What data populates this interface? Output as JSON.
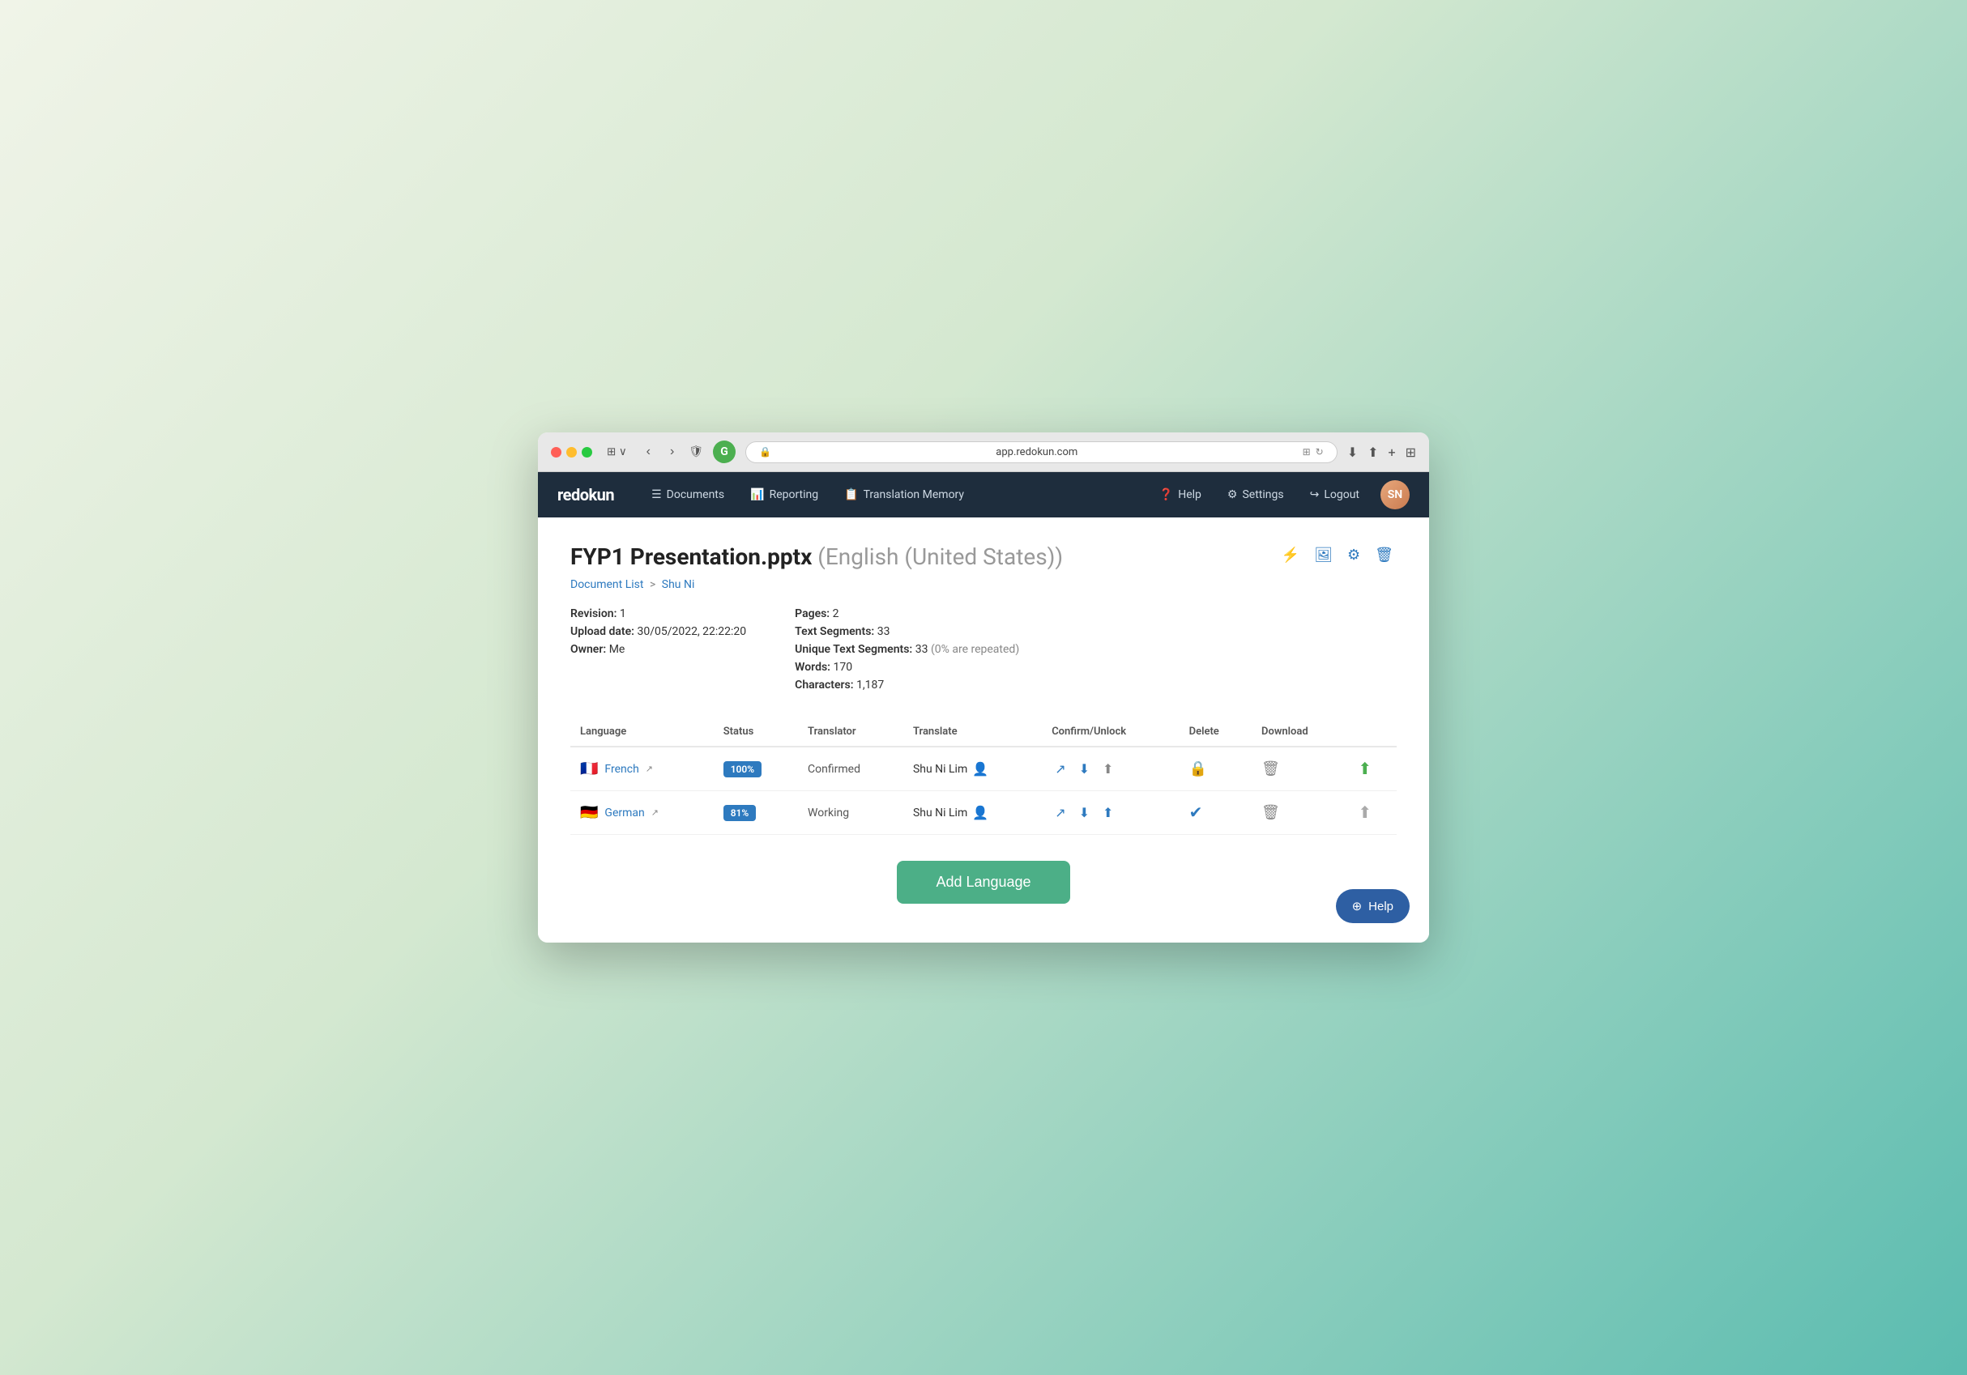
{
  "browser": {
    "url": "app.redokun.com"
  },
  "navbar": {
    "logo": "redokun",
    "links": [
      {
        "id": "documents",
        "icon": "☰",
        "label": "Documents"
      },
      {
        "id": "reporting",
        "icon": "📊",
        "label": "Reporting"
      },
      {
        "id": "translation-memory",
        "icon": "📋",
        "label": "Translation Memory"
      }
    ],
    "right_links": [
      {
        "id": "help",
        "icon": "❓",
        "label": "Help"
      },
      {
        "id": "settings",
        "icon": "⚙",
        "label": "Settings"
      },
      {
        "id": "logout",
        "icon": "↪",
        "label": "Logout"
      }
    ]
  },
  "page": {
    "title": "FYP1 Presentation.pptx",
    "title_lang": "(English (United States))",
    "breadcrumb_list": "Document List",
    "breadcrumb_separator": ">",
    "breadcrumb_current": "Shu Ni",
    "revision_label": "Revision:",
    "revision_value": "1",
    "upload_date_label": "Upload date:",
    "upload_date_value": "30/05/2022, 22:22:20",
    "owner_label": "Owner:",
    "owner_value": "Me",
    "pages_label": "Pages:",
    "pages_value": "2",
    "text_segments_label": "Text Segments:",
    "text_segments_value": "33",
    "unique_segments_label": "Unique Text Segments:",
    "unique_segments_value": "33",
    "unique_segments_note": "(0% are repeated)",
    "words_label": "Words:",
    "words_value": "170",
    "characters_label": "Characters:",
    "characters_value": "1,187"
  },
  "table": {
    "headers": [
      "Language",
      "Status",
      "Translator",
      "Translate",
      "Confirm/Unlock",
      "Delete",
      "Download"
    ],
    "rows": [
      {
        "flag": "🇫🇷",
        "language": "French",
        "badge": "100%",
        "status": "Confirmed",
        "translator": "Shu Ni Lim",
        "confirm_icon": "lock",
        "download_type": "green"
      },
      {
        "flag": "🇩🇪",
        "language": "German",
        "badge": "81%",
        "status": "Working",
        "translator": "Shu Ni Lim",
        "confirm_icon": "check",
        "download_type": "gray"
      }
    ]
  },
  "add_language_btn": "Add Language",
  "help_btn": "Help"
}
